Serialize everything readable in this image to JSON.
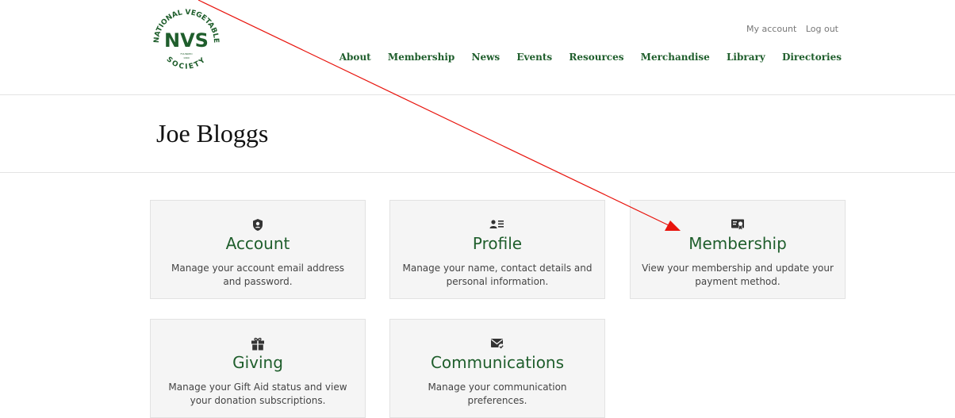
{
  "logo": {
    "top_text": "NATIONAL VEGETABLE",
    "initials": "NVS",
    "bottom_text": "SOCIETY",
    "founded": "FOUNDED",
    "year": "1960"
  },
  "util_links": {
    "my_account": "My account",
    "log_out": "Log out"
  },
  "nav": [
    "About",
    "Membership",
    "News",
    "Events",
    "Resources",
    "Merchandise",
    "Library",
    "Directories"
  ],
  "page": {
    "title": "Joe Bloggs"
  },
  "cards": [
    {
      "icon": "shield-user-icon",
      "title": "Account",
      "desc": "Manage your account email address and password."
    },
    {
      "icon": "profile-list-icon",
      "title": "Profile",
      "desc": "Manage your name, contact details and personal information."
    },
    {
      "icon": "certificate-icon",
      "title": "Membership",
      "desc": "View your membership and update your payment method."
    },
    {
      "icon": "gift-icon",
      "title": "Giving",
      "desc": "Manage your Gift Aid status and view your donation subscriptions."
    },
    {
      "icon": "envelope-check-icon",
      "title": "Communications",
      "desc": "Manage your communication preferences."
    }
  ],
  "colors": {
    "brand_green": "#1f5e2c",
    "card_bg": "#f5f5f5",
    "annotation_arrow": "#e8140d"
  }
}
